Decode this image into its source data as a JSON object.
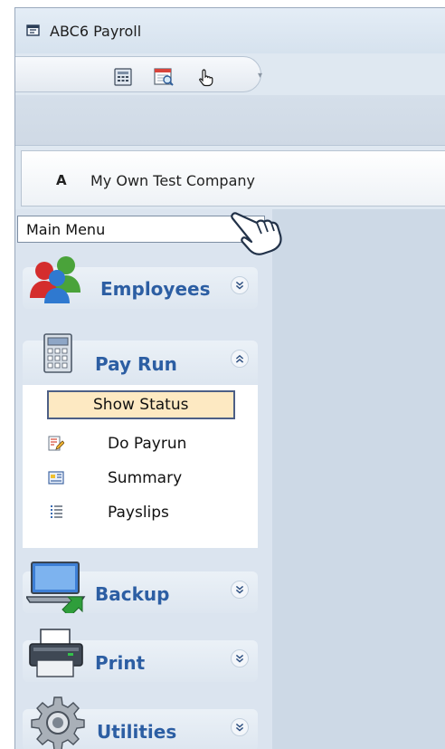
{
  "window": {
    "title": "ABC6 Payroll"
  },
  "quick_access": {
    "buttons": [
      {
        "icon": "calculator-icon"
      },
      {
        "icon": "calendar-search-icon"
      },
      {
        "icon": "hand-pointer-icon"
      }
    ],
    "dropdown_icon": "chevron-down-icon"
  },
  "company": {
    "letter": "A",
    "name": "My Own Test Company"
  },
  "menu_select": {
    "value": "Main Menu"
  },
  "sections": {
    "employees": {
      "title": "Employees",
      "state": "collapsed"
    },
    "payrun": {
      "title": "Pay Run",
      "state": "expanded",
      "items": [
        {
          "label": "Show Status",
          "icon": "status-icon",
          "selected": true
        },
        {
          "label": "Do Payrun",
          "icon": "edit-document-icon"
        },
        {
          "label": "Summary",
          "icon": "summary-card-icon"
        },
        {
          "label": "Payslips",
          "icon": "list-icon"
        }
      ]
    },
    "backup": {
      "title": "Backup",
      "state": "collapsed"
    },
    "print": {
      "title": "Print",
      "state": "collapsed"
    },
    "utilities": {
      "title": "Utilities",
      "state": "collapsed"
    }
  },
  "colors": {
    "section_title": "#2c5ea3",
    "selected_item_bg": "#fde9c2",
    "selected_item_border": "#4d5f86",
    "content_bg": "#cdd9e6"
  }
}
